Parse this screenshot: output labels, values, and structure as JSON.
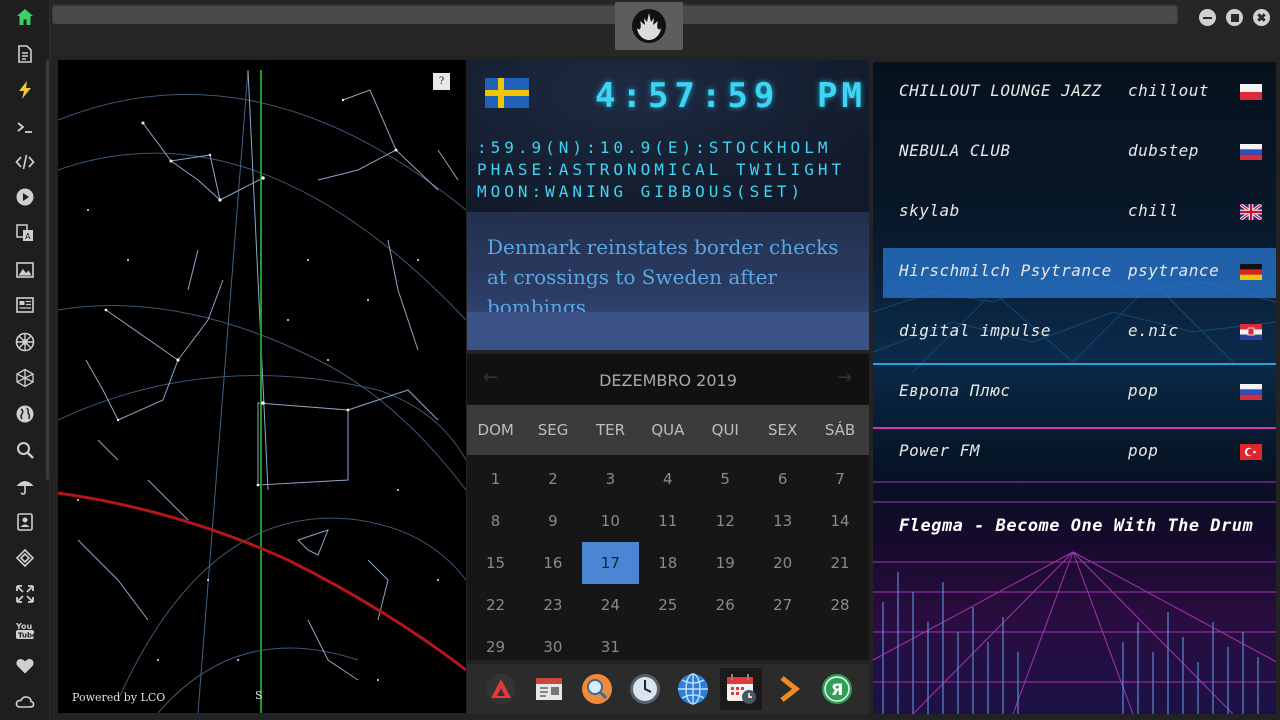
{
  "sidebar": {
    "items": [
      {
        "icon": "home-icon",
        "color": "#3ecf6b"
      },
      {
        "icon": "document-icon"
      },
      {
        "icon": "lightning-icon"
      },
      {
        "icon": "terminal-icon"
      },
      {
        "icon": "code-icon"
      },
      {
        "icon": "play-icon"
      },
      {
        "icon": "translate-icon"
      },
      {
        "icon": "image-icon"
      },
      {
        "icon": "news-icon"
      },
      {
        "icon": "empire-icon"
      },
      {
        "icon": "polyhedron-icon"
      },
      {
        "icon": "globe-icon"
      },
      {
        "icon": "search-icon"
      },
      {
        "icon": "umbrella-icon"
      },
      {
        "icon": "contact-icon"
      },
      {
        "icon": "codepen-icon"
      },
      {
        "icon": "fullscreen-icon"
      },
      {
        "icon": "youtube-icon"
      },
      {
        "icon": "heart-icon"
      },
      {
        "icon": "cloud-icon"
      }
    ]
  },
  "titlebar": {
    "emblem": "rebel-alliance-icon",
    "controls": [
      "minimize-icon",
      "maximize-icon",
      "close-icon"
    ]
  },
  "sky": {
    "help_label": "?",
    "powered_by": "Powered by LCO",
    "south_label": "S"
  },
  "clock": {
    "flag": "sweden",
    "time": "4:57:59",
    "ampm": "PM",
    "line1": ":59.9(N):10.9(E):STOCKHOLM",
    "line2": "PHASE:ASTRONOMICAL TWILIGHT",
    "line3": "MOON:WANING GIBBOUS(SET)",
    "headline": "Denmark reinstates border checks at crossings to Sweden after bombings",
    "accent": "#3fd4f2"
  },
  "calendar": {
    "prev": "←",
    "next": "→",
    "month": "DEZEMBRO 2019",
    "weekdays": [
      "DOM",
      "SEG",
      "TER",
      "QUA",
      "QUI",
      "SEX",
      "SÁB"
    ],
    "days": [
      "1",
      "2",
      "3",
      "4",
      "5",
      "6",
      "7",
      "8",
      "9",
      "10",
      "11",
      "12",
      "13",
      "14",
      "15",
      "16",
      "17",
      "18",
      "19",
      "20",
      "21",
      "22",
      "23",
      "24",
      "25",
      "26",
      "27",
      "28",
      "29",
      "30",
      "31"
    ],
    "first_weekday_index": 0,
    "selected": "17",
    "selected_color": "#4a86d4"
  },
  "dock": {
    "items": [
      "arch-app-icon",
      "calendar-doc-icon",
      "magnifier-icon",
      "clock-icon",
      "globe-icon",
      "calendar-clock-icon",
      "forward-arrow-icon",
      "yandex-icon"
    ],
    "active": "calendar-clock-icon"
  },
  "radio": {
    "stations": [
      {
        "name": "CHILLOUT LOUNGE JAZZ",
        "genre": "chillout",
        "flag": "poland"
      },
      {
        "name": "NEBULA CLUB",
        "genre": "dubstep",
        "flag": "russia"
      },
      {
        "name": "skylab",
        "genre": "chill",
        "flag": "uk"
      },
      {
        "name": "Hirschmilch Psytrance",
        "genre": "psytrance",
        "flag": "germany"
      },
      {
        "name": "digital impulse",
        "genre": "e.nic",
        "flag": "croatia"
      },
      {
        "name": "Европа Плюс",
        "genre": "pop",
        "flag": "russia"
      },
      {
        "name": "Power FM",
        "genre": "pop",
        "flag": "turkey"
      }
    ],
    "highlighted": 3,
    "now_playing": "Flegma - Become One With The Drum"
  }
}
